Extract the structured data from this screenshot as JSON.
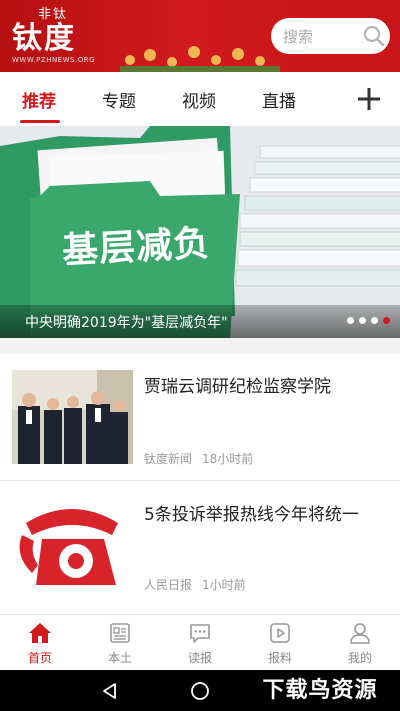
{
  "header": {
    "logo_small": "非钛",
    "logo_big": "钛度",
    "logo_url": "WWW.PZHNEWS.ORG",
    "search_placeholder": "搜索",
    "brand_color": "#d11a1d"
  },
  "tabs": [
    {
      "label": "推荐",
      "active": true
    },
    {
      "label": "专题",
      "active": false
    },
    {
      "label": "视频",
      "active": false
    },
    {
      "label": "直播",
      "active": false
    }
  ],
  "banner": {
    "image_text": "基层减负",
    "caption": "中央明确2019年为\"基层减负年\"",
    "slides_total": 4,
    "active_slide": 4
  },
  "news": [
    {
      "title": "贾瑞云调研纪检监察学院",
      "source": "钛度新闻",
      "time": "18小时前",
      "thumb_icon": "meeting-photo"
    },
    {
      "title": "5条投诉举报热线今年将统一",
      "source": "人民日报",
      "time": "1小时前",
      "thumb_icon": "red-telephone"
    }
  ],
  "bottom_nav": [
    {
      "label": "首页",
      "icon": "home-icon",
      "active": true
    },
    {
      "label": "本土",
      "icon": "newspaper-icon",
      "active": false
    },
    {
      "label": "读报",
      "icon": "chat-bubble-icon",
      "active": false
    },
    {
      "label": "报料",
      "icon": "play-icon",
      "active": false
    },
    {
      "label": "我的",
      "icon": "person-icon",
      "active": false
    }
  ],
  "watermark": "下载鸟资源"
}
